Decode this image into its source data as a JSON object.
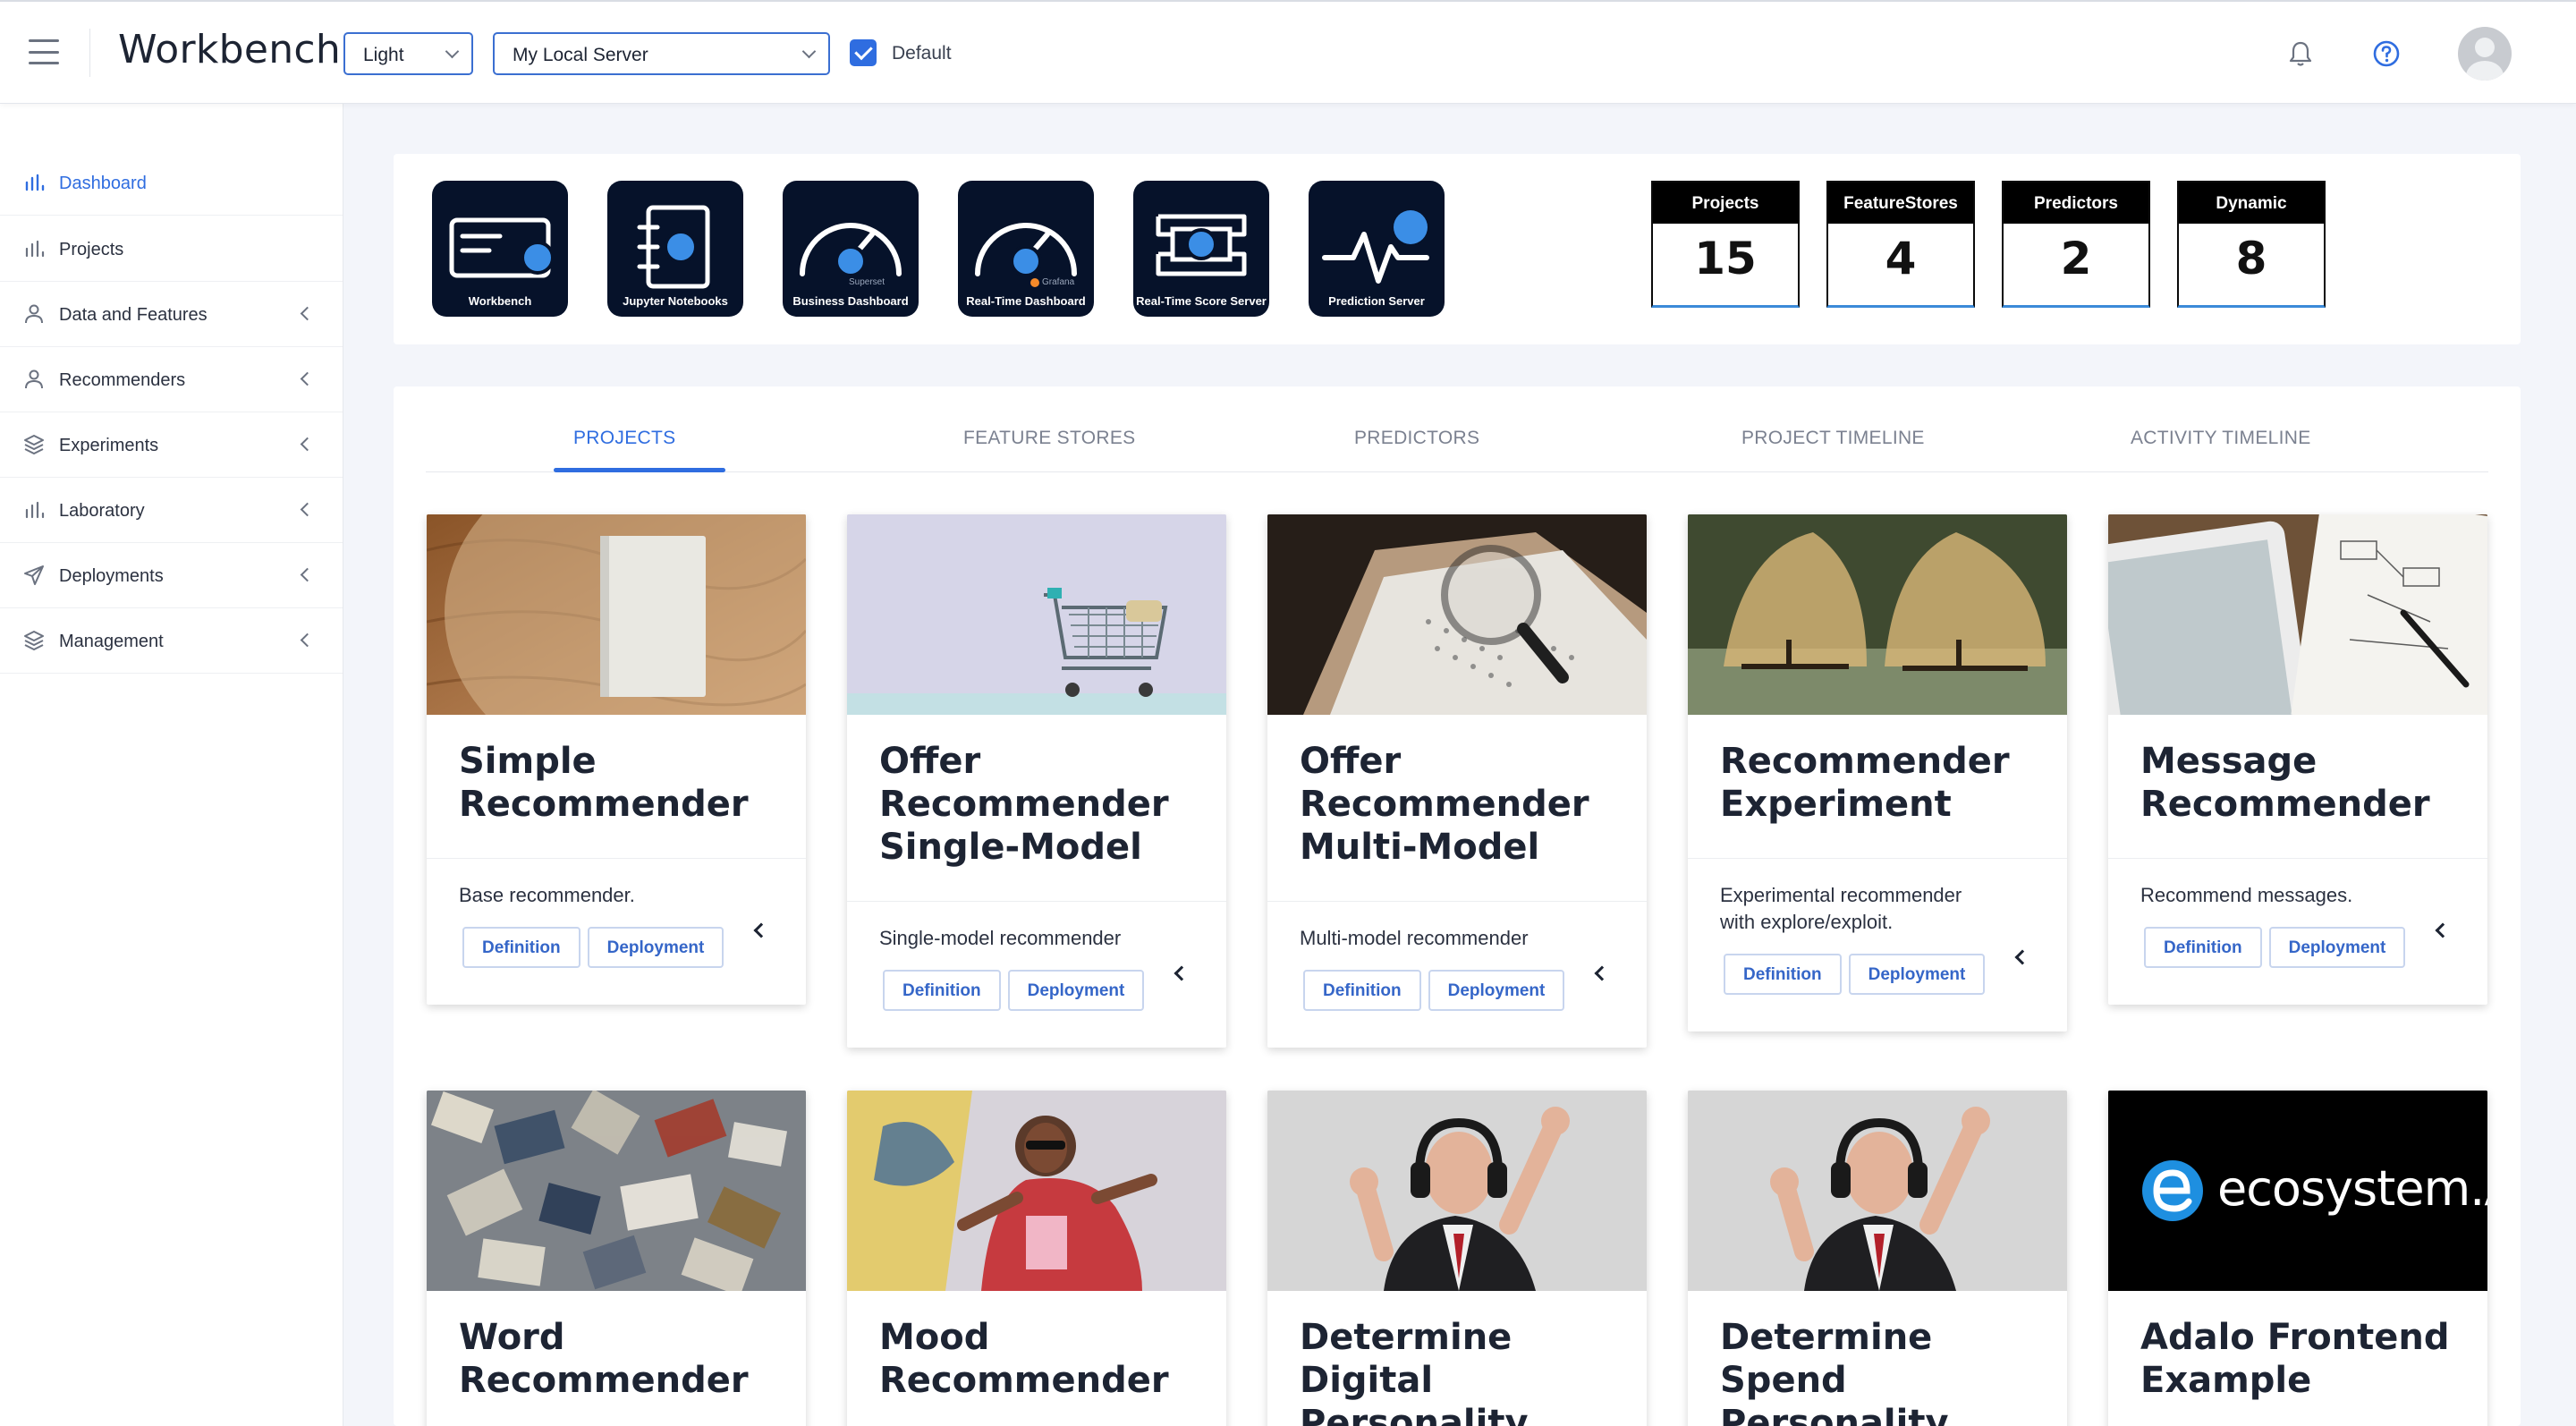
{
  "header": {
    "title": "Workbench",
    "theme_select": "Light",
    "server_select": "My Local Server",
    "default_checkbox_label": "Default",
    "default_checked": true
  },
  "sidebar": {
    "items": [
      {
        "label": "Dashboard",
        "icon": "bar-chart-icon",
        "active": true
      },
      {
        "label": "Projects",
        "icon": "bar-chart-icon"
      },
      {
        "label": "Data and Features",
        "icon": "user-icon"
      },
      {
        "label": "Recommenders",
        "icon": "user-icon"
      },
      {
        "label": "Experiments",
        "icon": "layers-icon"
      },
      {
        "label": "Laboratory",
        "icon": "bar-chart-icon"
      },
      {
        "label": "Deployments",
        "icon": "send-icon"
      },
      {
        "label": "Management",
        "icon": "layers-icon"
      }
    ]
  },
  "launchers": [
    {
      "label": "Workbench",
      "icon": "workbench-icon"
    },
    {
      "label": "Jupyter Notebooks",
      "icon": "notebook-icon"
    },
    {
      "label": "Business Dashboard",
      "icon": "gauge-icon",
      "sublabel": "Superset"
    },
    {
      "label": "Real-Time Dashboard",
      "icon": "gauge-icon",
      "sublabel": "Grafana"
    },
    {
      "label": "Real-Time Score Server",
      "icon": "server-icon"
    },
    {
      "label": "Prediction Server",
      "icon": "pulse-icon"
    }
  ],
  "stats": [
    {
      "label": "Projects",
      "value": "15"
    },
    {
      "label": "FeatureStores",
      "value": "4"
    },
    {
      "label": "Predictors",
      "value": "2"
    },
    {
      "label": "Dynamic",
      "value": "8"
    }
  ],
  "tabs": [
    {
      "label": "PROJECTS",
      "active": true
    },
    {
      "label": "FEATURE STORES"
    },
    {
      "label": "PREDICTORS"
    },
    {
      "label": "PROJECT TIMELINE"
    },
    {
      "label": "ACTIVITY TIMELINE"
    }
  ],
  "buttons": {
    "definition": "Definition",
    "deployment": "Deployment"
  },
  "projects": [
    {
      "title": "Simple Recommender",
      "description": "Base recommender.",
      "image": "book-on-wood"
    },
    {
      "title": "Offer Recommender Single-Model",
      "description": "Single-model recommender",
      "image": "shopping-cart"
    },
    {
      "title": "Offer Recommender Multi-Model",
      "description": "Multi-model recommender",
      "image": "magnifying-glass"
    },
    {
      "title": "Recommender Experiment",
      "description": "Experimental recommender with explore/exploit.",
      "image": "fishing-nets"
    },
    {
      "title": "Message Recommender",
      "description": "Recommend messages.",
      "image": "tablet-notes"
    },
    {
      "title": "Word Recommender",
      "description": "",
      "image": "magazines"
    },
    {
      "title": "Mood Recommender",
      "description": "",
      "image": "dancing-woman"
    },
    {
      "title": "Determine Digital Personality",
      "description": "",
      "image": "man-headphones"
    },
    {
      "title": "Determine Spend Personality",
      "description": "",
      "image": "man-headphones"
    },
    {
      "title": "Adalo Frontend Example",
      "description": "",
      "image": "ecosystem-logo",
      "logo_text": "ecosystem.Ai"
    }
  ]
}
